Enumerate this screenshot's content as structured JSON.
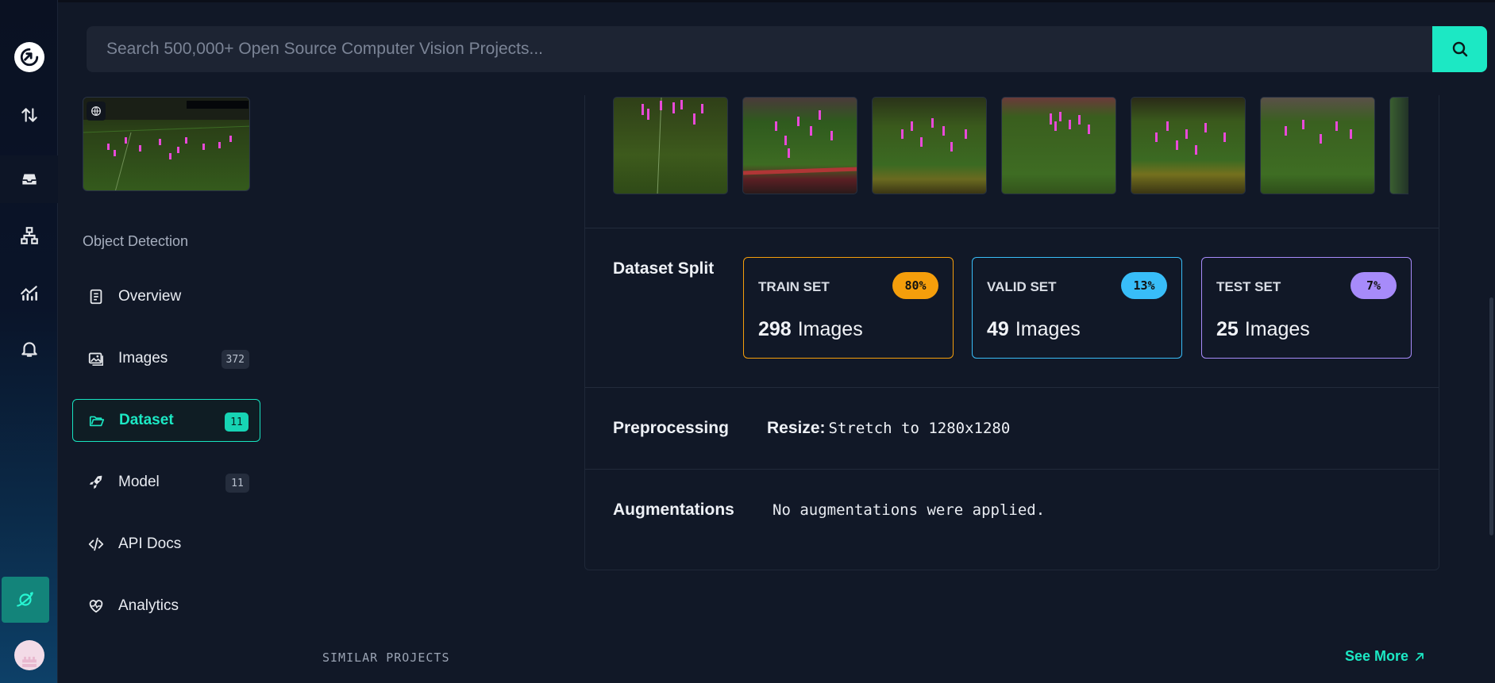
{
  "search": {
    "placeholder": "Search 500,000+ Open Source Computer Vision Projects..."
  },
  "rail": {
    "items": [
      "logo-icon",
      "upload-download-icon",
      "inbox-icon",
      "workflow-icon",
      "chart-icon",
      "bell-icon",
      "universe-icon",
      "avatar"
    ]
  },
  "project": {
    "type_label": "Object Detection"
  },
  "nav": {
    "items": [
      {
        "label": "Overview",
        "icon": "book-icon"
      },
      {
        "label": "Images",
        "icon": "images-icon",
        "count": "372"
      },
      {
        "label": "Dataset",
        "icon": "folder-icon",
        "count": "11",
        "active": true
      },
      {
        "label": "Model",
        "icon": "rocket-icon",
        "count": "11"
      },
      {
        "label": "API Docs",
        "icon": "code-icon"
      },
      {
        "label": "Analytics",
        "icon": "heart-pulse-icon"
      }
    ]
  },
  "split": {
    "title": "Dataset Split",
    "cards": [
      {
        "label": "TRAIN SET",
        "pct": "80%",
        "count": "298",
        "unit": "Images",
        "color": "#f59e0b"
      },
      {
        "label": "VALID SET",
        "pct": "13%",
        "count": "49",
        "unit": "Images",
        "color": "#38bdf8"
      },
      {
        "label": "TEST SET",
        "pct": "7%",
        "count": "25",
        "unit": "Images",
        "color": "#a78bfa"
      }
    ]
  },
  "preprocessing": {
    "title": "Preprocessing",
    "key": "Resize:",
    "value": "Stretch to 1280x1280"
  },
  "augmentations": {
    "title": "Augmentations",
    "value": "No augmentations were applied."
  },
  "footer": {
    "similar": "SIMILAR PROJECTS",
    "see_more": "See More"
  },
  "colors": {
    "accent": "#1ce8c4",
    "background": "#111827"
  }
}
